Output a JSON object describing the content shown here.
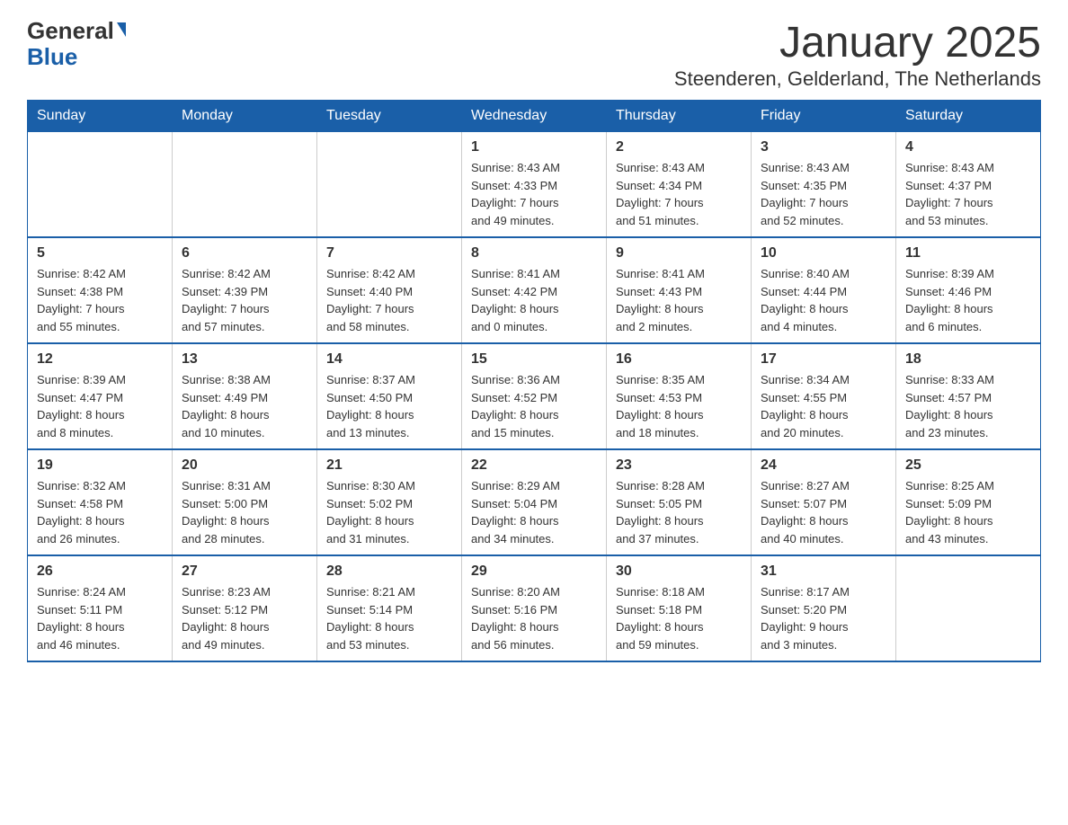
{
  "header": {
    "logo_text_general": "General",
    "logo_text_blue": "Blue",
    "month_title": "January 2025",
    "location": "Steenderen, Gelderland, The Netherlands"
  },
  "weekdays": [
    "Sunday",
    "Monday",
    "Tuesday",
    "Wednesday",
    "Thursday",
    "Friday",
    "Saturday"
  ],
  "weeks": [
    [
      {
        "day": "",
        "info": ""
      },
      {
        "day": "",
        "info": ""
      },
      {
        "day": "",
        "info": ""
      },
      {
        "day": "1",
        "info": "Sunrise: 8:43 AM\nSunset: 4:33 PM\nDaylight: 7 hours\nand 49 minutes."
      },
      {
        "day": "2",
        "info": "Sunrise: 8:43 AM\nSunset: 4:34 PM\nDaylight: 7 hours\nand 51 minutes."
      },
      {
        "day": "3",
        "info": "Sunrise: 8:43 AM\nSunset: 4:35 PM\nDaylight: 7 hours\nand 52 minutes."
      },
      {
        "day": "4",
        "info": "Sunrise: 8:43 AM\nSunset: 4:37 PM\nDaylight: 7 hours\nand 53 minutes."
      }
    ],
    [
      {
        "day": "5",
        "info": "Sunrise: 8:42 AM\nSunset: 4:38 PM\nDaylight: 7 hours\nand 55 minutes."
      },
      {
        "day": "6",
        "info": "Sunrise: 8:42 AM\nSunset: 4:39 PM\nDaylight: 7 hours\nand 57 minutes."
      },
      {
        "day": "7",
        "info": "Sunrise: 8:42 AM\nSunset: 4:40 PM\nDaylight: 7 hours\nand 58 minutes."
      },
      {
        "day": "8",
        "info": "Sunrise: 8:41 AM\nSunset: 4:42 PM\nDaylight: 8 hours\nand 0 minutes."
      },
      {
        "day": "9",
        "info": "Sunrise: 8:41 AM\nSunset: 4:43 PM\nDaylight: 8 hours\nand 2 minutes."
      },
      {
        "day": "10",
        "info": "Sunrise: 8:40 AM\nSunset: 4:44 PM\nDaylight: 8 hours\nand 4 minutes."
      },
      {
        "day": "11",
        "info": "Sunrise: 8:39 AM\nSunset: 4:46 PM\nDaylight: 8 hours\nand 6 minutes."
      }
    ],
    [
      {
        "day": "12",
        "info": "Sunrise: 8:39 AM\nSunset: 4:47 PM\nDaylight: 8 hours\nand 8 minutes."
      },
      {
        "day": "13",
        "info": "Sunrise: 8:38 AM\nSunset: 4:49 PM\nDaylight: 8 hours\nand 10 minutes."
      },
      {
        "day": "14",
        "info": "Sunrise: 8:37 AM\nSunset: 4:50 PM\nDaylight: 8 hours\nand 13 minutes."
      },
      {
        "day": "15",
        "info": "Sunrise: 8:36 AM\nSunset: 4:52 PM\nDaylight: 8 hours\nand 15 minutes."
      },
      {
        "day": "16",
        "info": "Sunrise: 8:35 AM\nSunset: 4:53 PM\nDaylight: 8 hours\nand 18 minutes."
      },
      {
        "day": "17",
        "info": "Sunrise: 8:34 AM\nSunset: 4:55 PM\nDaylight: 8 hours\nand 20 minutes."
      },
      {
        "day": "18",
        "info": "Sunrise: 8:33 AM\nSunset: 4:57 PM\nDaylight: 8 hours\nand 23 minutes."
      }
    ],
    [
      {
        "day": "19",
        "info": "Sunrise: 8:32 AM\nSunset: 4:58 PM\nDaylight: 8 hours\nand 26 minutes."
      },
      {
        "day": "20",
        "info": "Sunrise: 8:31 AM\nSunset: 5:00 PM\nDaylight: 8 hours\nand 28 minutes."
      },
      {
        "day": "21",
        "info": "Sunrise: 8:30 AM\nSunset: 5:02 PM\nDaylight: 8 hours\nand 31 minutes."
      },
      {
        "day": "22",
        "info": "Sunrise: 8:29 AM\nSunset: 5:04 PM\nDaylight: 8 hours\nand 34 minutes."
      },
      {
        "day": "23",
        "info": "Sunrise: 8:28 AM\nSunset: 5:05 PM\nDaylight: 8 hours\nand 37 minutes."
      },
      {
        "day": "24",
        "info": "Sunrise: 8:27 AM\nSunset: 5:07 PM\nDaylight: 8 hours\nand 40 minutes."
      },
      {
        "day": "25",
        "info": "Sunrise: 8:25 AM\nSunset: 5:09 PM\nDaylight: 8 hours\nand 43 minutes."
      }
    ],
    [
      {
        "day": "26",
        "info": "Sunrise: 8:24 AM\nSunset: 5:11 PM\nDaylight: 8 hours\nand 46 minutes."
      },
      {
        "day": "27",
        "info": "Sunrise: 8:23 AM\nSunset: 5:12 PM\nDaylight: 8 hours\nand 49 minutes."
      },
      {
        "day": "28",
        "info": "Sunrise: 8:21 AM\nSunset: 5:14 PM\nDaylight: 8 hours\nand 53 minutes."
      },
      {
        "day": "29",
        "info": "Sunrise: 8:20 AM\nSunset: 5:16 PM\nDaylight: 8 hours\nand 56 minutes."
      },
      {
        "day": "30",
        "info": "Sunrise: 8:18 AM\nSunset: 5:18 PM\nDaylight: 8 hours\nand 59 minutes."
      },
      {
        "day": "31",
        "info": "Sunrise: 8:17 AM\nSunset: 5:20 PM\nDaylight: 9 hours\nand 3 minutes."
      },
      {
        "day": "",
        "info": ""
      }
    ]
  ]
}
